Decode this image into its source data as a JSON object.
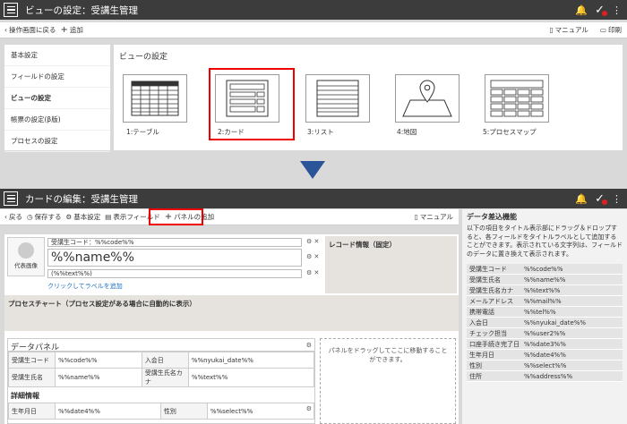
{
  "top": {
    "title": "ビューの設定：受講生管理",
    "back_label": "操作画面に戻る",
    "add_label": "追加",
    "manual_label": "マニュアル",
    "print_label": "印刷",
    "sidebar": [
      {
        "label": "基本設定",
        "active": false
      },
      {
        "label": "フィールドの設定",
        "active": false
      },
      {
        "label": "ビューの設定",
        "active": true
      },
      {
        "label": "帳票の設定(β版)",
        "active": false
      },
      {
        "label": "プロセスの設定",
        "active": false
      }
    ],
    "section_title": "ビューの設定",
    "views": [
      {
        "label": "1:テーブル",
        "icon": "table-icon"
      },
      {
        "label": "2:カード",
        "icon": "card-icon",
        "selected": true
      },
      {
        "label": "3:リスト",
        "icon": "list-icon"
      },
      {
        "label": "4:地図",
        "icon": "map-icon"
      },
      {
        "label": "5:プロセスマップ",
        "icon": "process-map-icon"
      }
    ]
  },
  "bottom": {
    "title": "カードの編集：受講生管理",
    "toolbar": {
      "back": "戻る",
      "save": "保存する",
      "basic": "基本設定",
      "display_field": "表示フィールド",
      "add_panel": "パネルの追加",
      "manual": "マニュアル"
    },
    "card": {
      "image_label": "代表画像",
      "code_field": "受講生コード：%%code%%",
      "name_field": "%%name%%",
      "text_field": "(%%text%%)",
      "add_label_link": "クリックしてラベルを追加",
      "record_info": "レコード情報（固定）"
    },
    "process_chart": "プロセスチャート（プロセス設定がある場合に自動的に表示）",
    "data_panel": {
      "title": "データパネル",
      "rows": [
        [
          "受講生コード",
          "%%code%%",
          "入会日",
          "%%nyukai_date%%"
        ],
        [
          "受講生氏名",
          "%%name%%",
          "受講生氏名カナ",
          "%%text%%"
        ]
      ]
    },
    "detail": {
      "title": "詳細情報",
      "rows": [
        [
          "生年月日",
          "%%date4%%",
          "性別",
          "%%select%%"
        ]
      ]
    },
    "drop_zone": "パネルをドラッグしてここに移動することができます。",
    "right_panel": {
      "title": "データ差込機能",
      "desc": "以下の項目をタイトル表示部にドラッグ＆ドロップすると、各フィールドをタイトルラベルとして追加することができます。表示されている文字列は、フィールドのデータに置き換えて表示されます。",
      "fields": [
        [
          "受講生コード",
          "%%code%%"
        ],
        [
          "受講生氏名",
          "%%name%%"
        ],
        [
          "受講生氏名カナ",
          "%%text%%"
        ],
        [
          "メールアドレス",
          "%%mail%%"
        ],
        [
          "携帯電話",
          "%%tel%%"
        ],
        [
          "入会日",
          "%%nyukai_date%%"
        ],
        [
          "チェック担当",
          "%%user2%%"
        ],
        [
          "口座手続き完了日",
          "%%date3%%"
        ],
        [
          "生年月日",
          "%%date4%%"
        ],
        [
          "性別",
          "%%select%%"
        ],
        [
          "住所",
          "%%address%%"
        ]
      ]
    }
  }
}
